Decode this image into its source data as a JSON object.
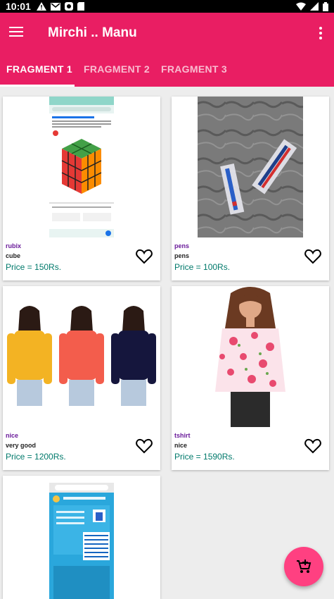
{
  "status_bar": {
    "time": "10:01"
  },
  "app_bar": {
    "title": "Mirchi .. Manu"
  },
  "tabs": [
    {
      "label": "FRAGMENT 1",
      "active": true
    },
    {
      "label": "FRAGMENT 2",
      "active": false
    },
    {
      "label": "FRAGMENT 3",
      "active": false
    }
  ],
  "products": [
    {
      "name": "rubix",
      "description": "cube",
      "price": "Price = 150Rs."
    },
    {
      "name": "pens",
      "description": "pens",
      "price": "Price = 100Rs."
    },
    {
      "name": "nice",
      "description": "very good",
      "price": "Price = 1200Rs."
    },
    {
      "name": "tshirt",
      "description": "nice",
      "price": "Price = 1590Rs."
    }
  ],
  "colors": {
    "primary": "#e91e63",
    "accent": "#ff4081",
    "price": "#00796b",
    "title": "#6a1b9a"
  }
}
